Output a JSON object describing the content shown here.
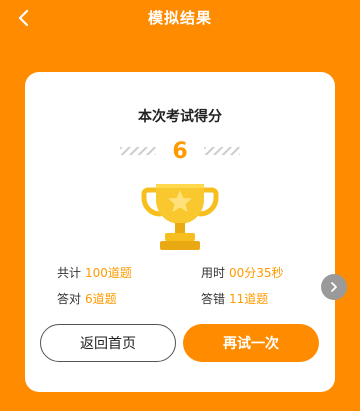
{
  "header": {
    "title": "模拟结果",
    "back_icon": "chevron-left-icon"
  },
  "result": {
    "heading": "本次考试得分",
    "score": "6",
    "trophy_icon": "trophy-icon"
  },
  "stats": {
    "total_label": "共计",
    "total_value": "100道题",
    "time_label": "用时",
    "time_value": "00分35秒",
    "correct_label": "答对",
    "correct_value": "6道题",
    "wrong_label": "答错",
    "wrong_value": "11道题"
  },
  "buttons": {
    "home_label": "返回首页",
    "retry_label": "再试一次"
  },
  "colors": {
    "accent": "#FF8C00",
    "highlight": "#FF9A00",
    "trophy": "#F6BF1E"
  }
}
